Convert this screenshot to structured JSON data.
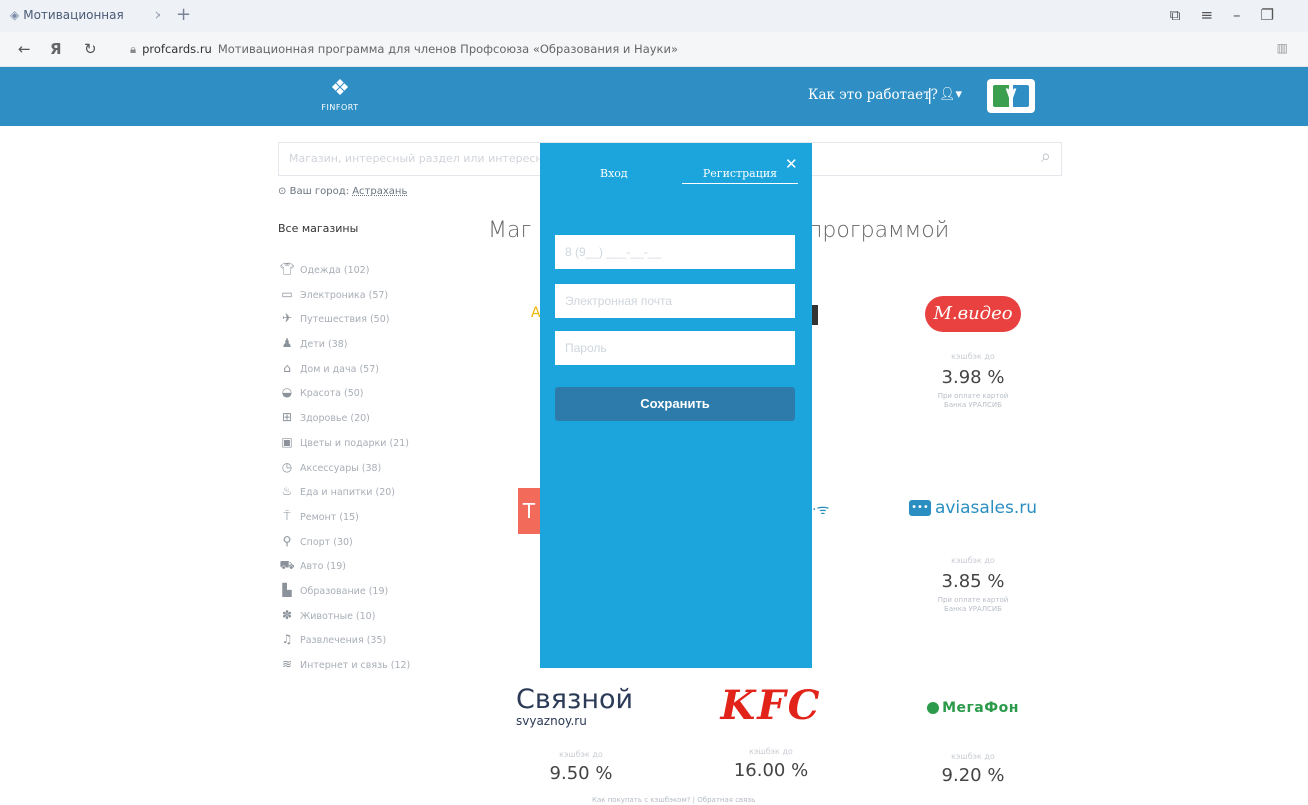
{
  "browser": {
    "tab_title": "Мотивационная",
    "domain": "profcards.ru",
    "page_title": "Мотивационная программа для членов Профсоюза «Образования и Науки»"
  },
  "header": {
    "logo_text": "FINFORT",
    "how_it_works": "Как это работает?",
    "separator": "|",
    "brand_color": "#2f8fc4"
  },
  "search": {
    "placeholder": "Магазин, интересный раздел или интересное"
  },
  "city": {
    "label": "Ваш город:",
    "value": "Астрахань"
  },
  "categories": {
    "heading": "Все магазины",
    "items": [
      {
        "label": "Одежда (102)",
        "icon": "shirt-icon"
      },
      {
        "label": "Электроника (57)",
        "icon": "monitor-icon"
      },
      {
        "label": "Путешествия (50)",
        "icon": "plane-icon"
      },
      {
        "label": "Дети (38)",
        "icon": "child-icon"
      },
      {
        "label": "Дом и дача (57)",
        "icon": "house-icon"
      },
      {
        "label": "Красота (50)",
        "icon": "lips-icon"
      },
      {
        "label": "Здоровье (20)",
        "icon": "medkit-icon"
      },
      {
        "label": "Цветы и подарки (21)",
        "icon": "gift-icon"
      },
      {
        "label": "Аксессуары (38)",
        "icon": "watch-icon"
      },
      {
        "label": "Еда и напитки (20)",
        "icon": "food-icon"
      },
      {
        "label": "Ремонт (15)",
        "icon": "paint-roller-icon"
      },
      {
        "label": "Спорт (30)",
        "icon": "sport-icon"
      },
      {
        "label": "Авто (19)",
        "icon": "car-icon"
      },
      {
        "label": "Образование (19)",
        "icon": "education-icon"
      },
      {
        "label": "Животные (10)",
        "icon": "paw-icon"
      },
      {
        "label": "Развлечения (35)",
        "icon": "music-icon"
      },
      {
        "label": "Интернет и связь (12)",
        "icon": "wifi-icon"
      }
    ]
  },
  "main": {
    "title_left": "Маг",
    "title_right": "программой"
  },
  "stores": {
    "mvideo": {
      "logo": "М.видео",
      "cashback_label": "кэшбэк до",
      "value": "3.98 %",
      "note_line1": "При оплате картой",
      "note_line2": "Банка УРАЛСИБ"
    },
    "aviasales": {
      "logo": "aviasales.ru",
      "logo_box": "•••",
      "cashback_label": "кэшбэк до",
      "value": "3.85 %",
      "note_line1": "При оплате картой",
      "note_line2": "Банка УРАЛСИБ"
    },
    "svyaznoy": {
      "logo_big": "Связной",
      "logo_small": "svyaznoy.ru",
      "cashback_label": "кэшбэк до",
      "value": "9.50 %"
    },
    "kfc": {
      "logo": "KFC",
      "cashback_label": "кэшбэк до",
      "value": "16.00 %"
    },
    "megafon": {
      "logo": "МегаФон",
      "cashback_label": "кэшбэк до",
      "value": "9.20 %"
    }
  },
  "footer": {
    "text": "Как покупать с кэшбэком? | Обратная связь"
  },
  "modal": {
    "tab_login": "Вход",
    "tab_register": "Регистрация",
    "phone_placeholder": "8 (9__) ___-__-__",
    "email_placeholder": "Электронная почта",
    "password_placeholder": "Пароль",
    "save_label": "Сохранить",
    "color": "#1ca5dc"
  }
}
